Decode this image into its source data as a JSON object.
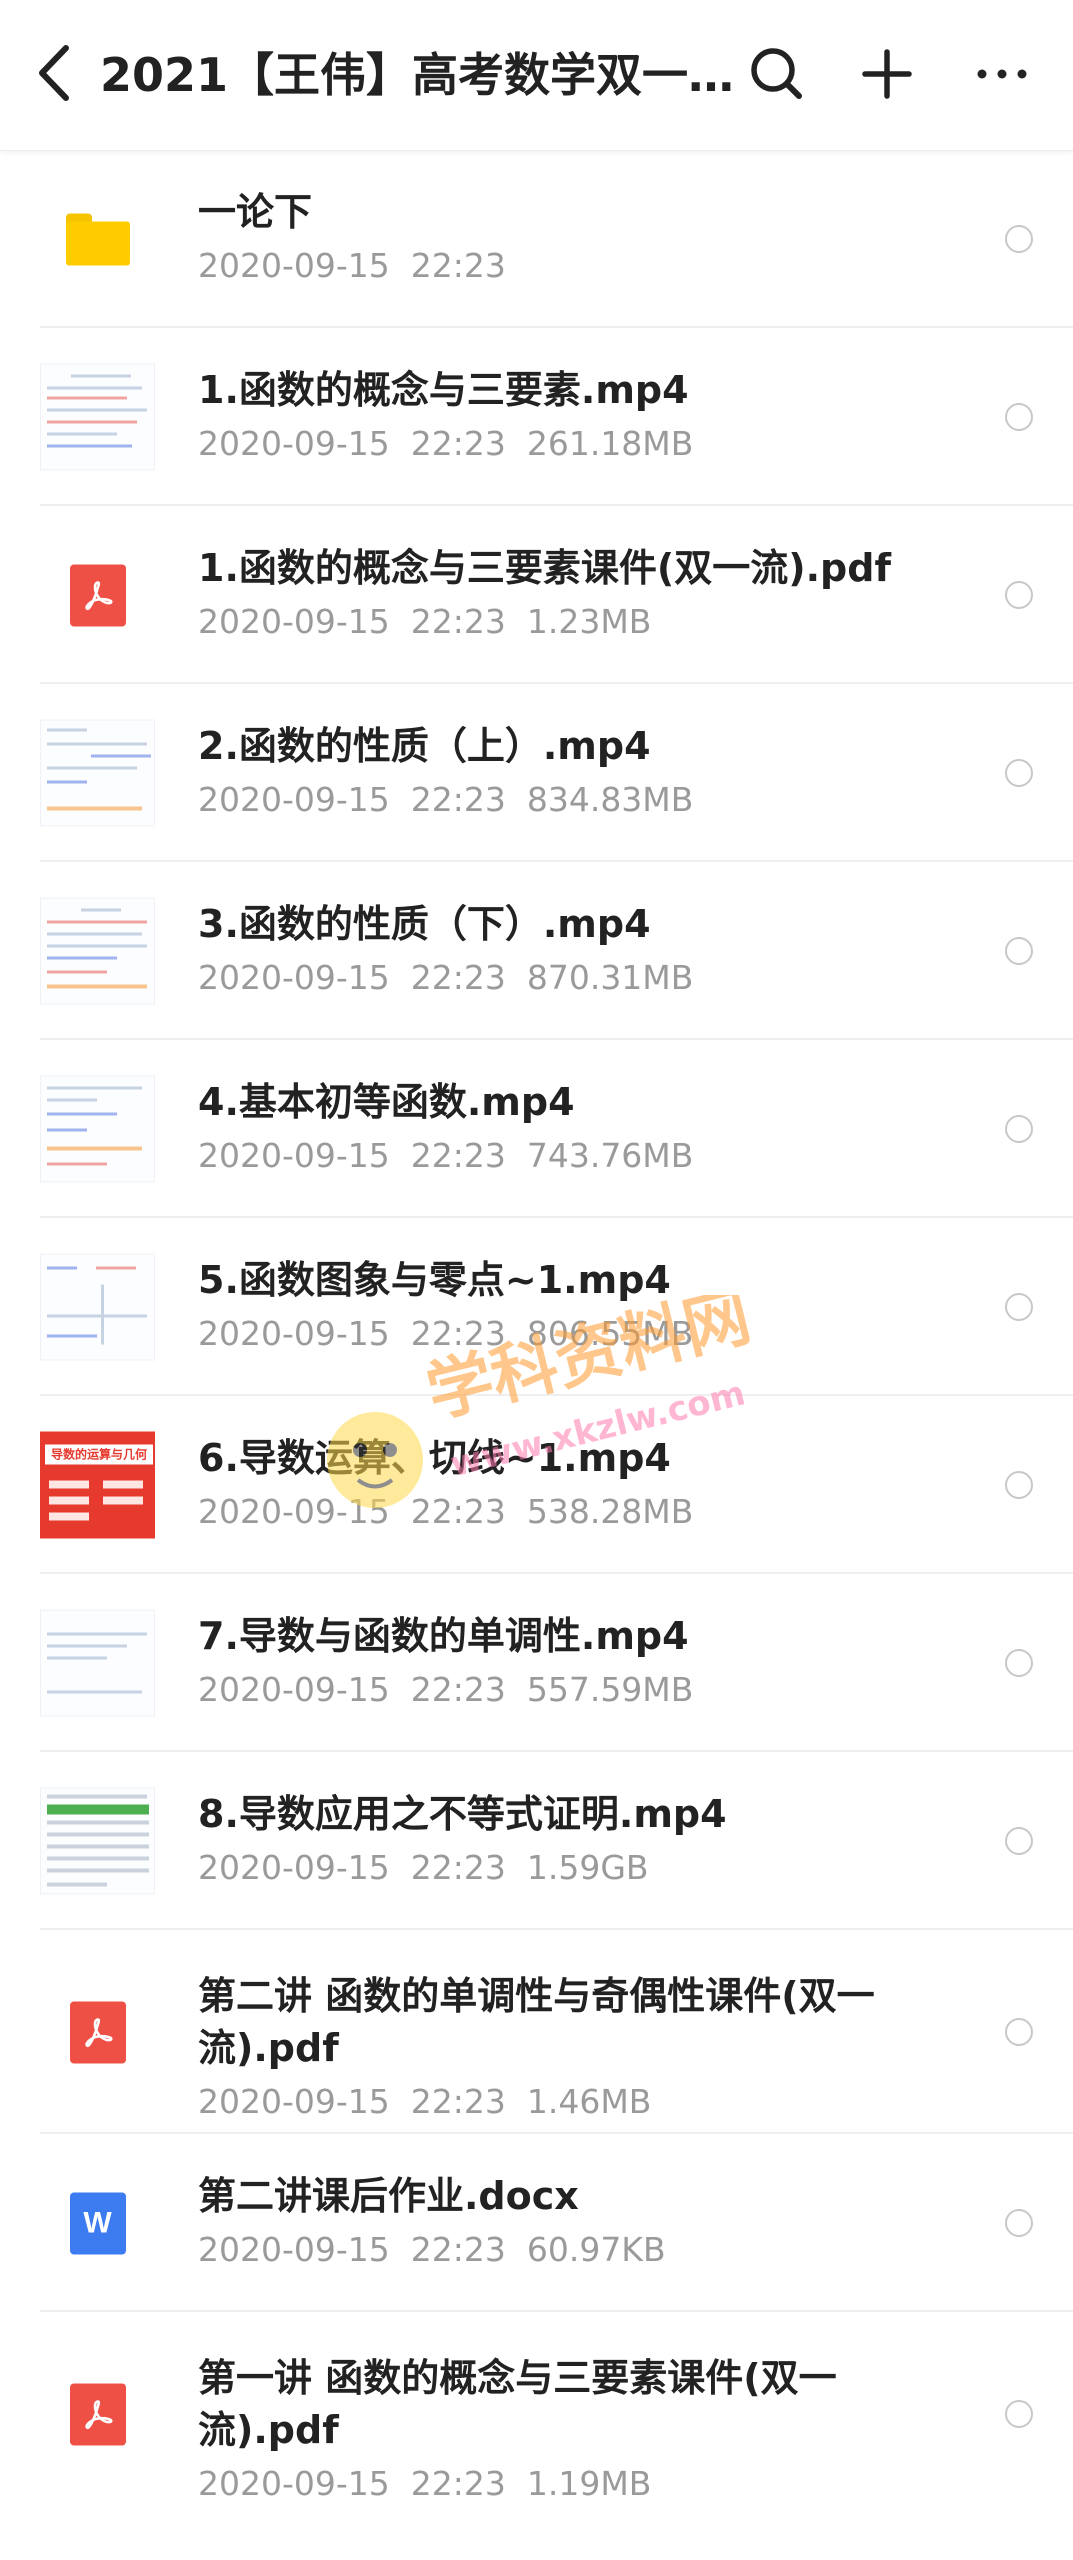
{
  "header": {
    "title": "2021【王伟】高考数学双一…",
    "icons": [
      "back-icon",
      "search-icon",
      "plus-icon",
      "more-icon"
    ]
  },
  "files": [
    {
      "name": "一论下",
      "meta": "2020-09-15  22:23",
      "type": "folder"
    },
    {
      "name": "1.函数的概念与三要素.mp4",
      "meta": "2020-09-15  22:23  261.18MB",
      "type": "video"
    },
    {
      "name": "1.函数的概念与三要素课件(双一流).pdf",
      "meta": "2020-09-15  22:23  1.23MB",
      "type": "pdf"
    },
    {
      "name": "2.函数的性质（上）.mp4",
      "meta": "2020-09-15  22:23  834.83MB",
      "type": "video"
    },
    {
      "name": "3.函数的性质（下）.mp4",
      "meta": "2020-09-15  22:23  870.31MB",
      "type": "video"
    },
    {
      "name": "4.基本初等函数.mp4",
      "meta": "2020-09-15  22:23  743.76MB",
      "type": "video"
    },
    {
      "name": "5.函数图象与零点~1.mp4",
      "meta": "2020-09-15  22:23  806.55MB",
      "type": "video"
    },
    {
      "name": "6.导数运算、切线~1.mp4",
      "meta": "2020-09-15  22:23  538.28MB",
      "type": "video-red"
    },
    {
      "name": "7.导数与函数的单调性.mp4",
      "meta": "2020-09-15  22:23  557.59MB",
      "type": "video"
    },
    {
      "name": "8.导数应用之不等式证明.mp4",
      "meta": "2020-09-15  22:23  1.59GB",
      "type": "video-table"
    },
    {
      "name": "第二讲 函数的单调性与奇偶性课件(双一流).pdf",
      "meta": "2020-09-15  22:23  1.46MB",
      "type": "pdf"
    },
    {
      "name": "第二讲课后作业.docx",
      "meta": "2020-09-15  22:23  60.97KB",
      "type": "word"
    },
    {
      "name": "第一讲 函数的概念与三要素课件(双一流).pdf",
      "meta": "2020-09-15  22:23  1.19MB",
      "type": "pdf"
    }
  ],
  "thumb_text": {
    "word_letter": "W",
    "red_banner": "导数的运算与几何"
  },
  "watermark": {
    "text": "学科资料网",
    "url": "www.xkzlw.com"
  }
}
